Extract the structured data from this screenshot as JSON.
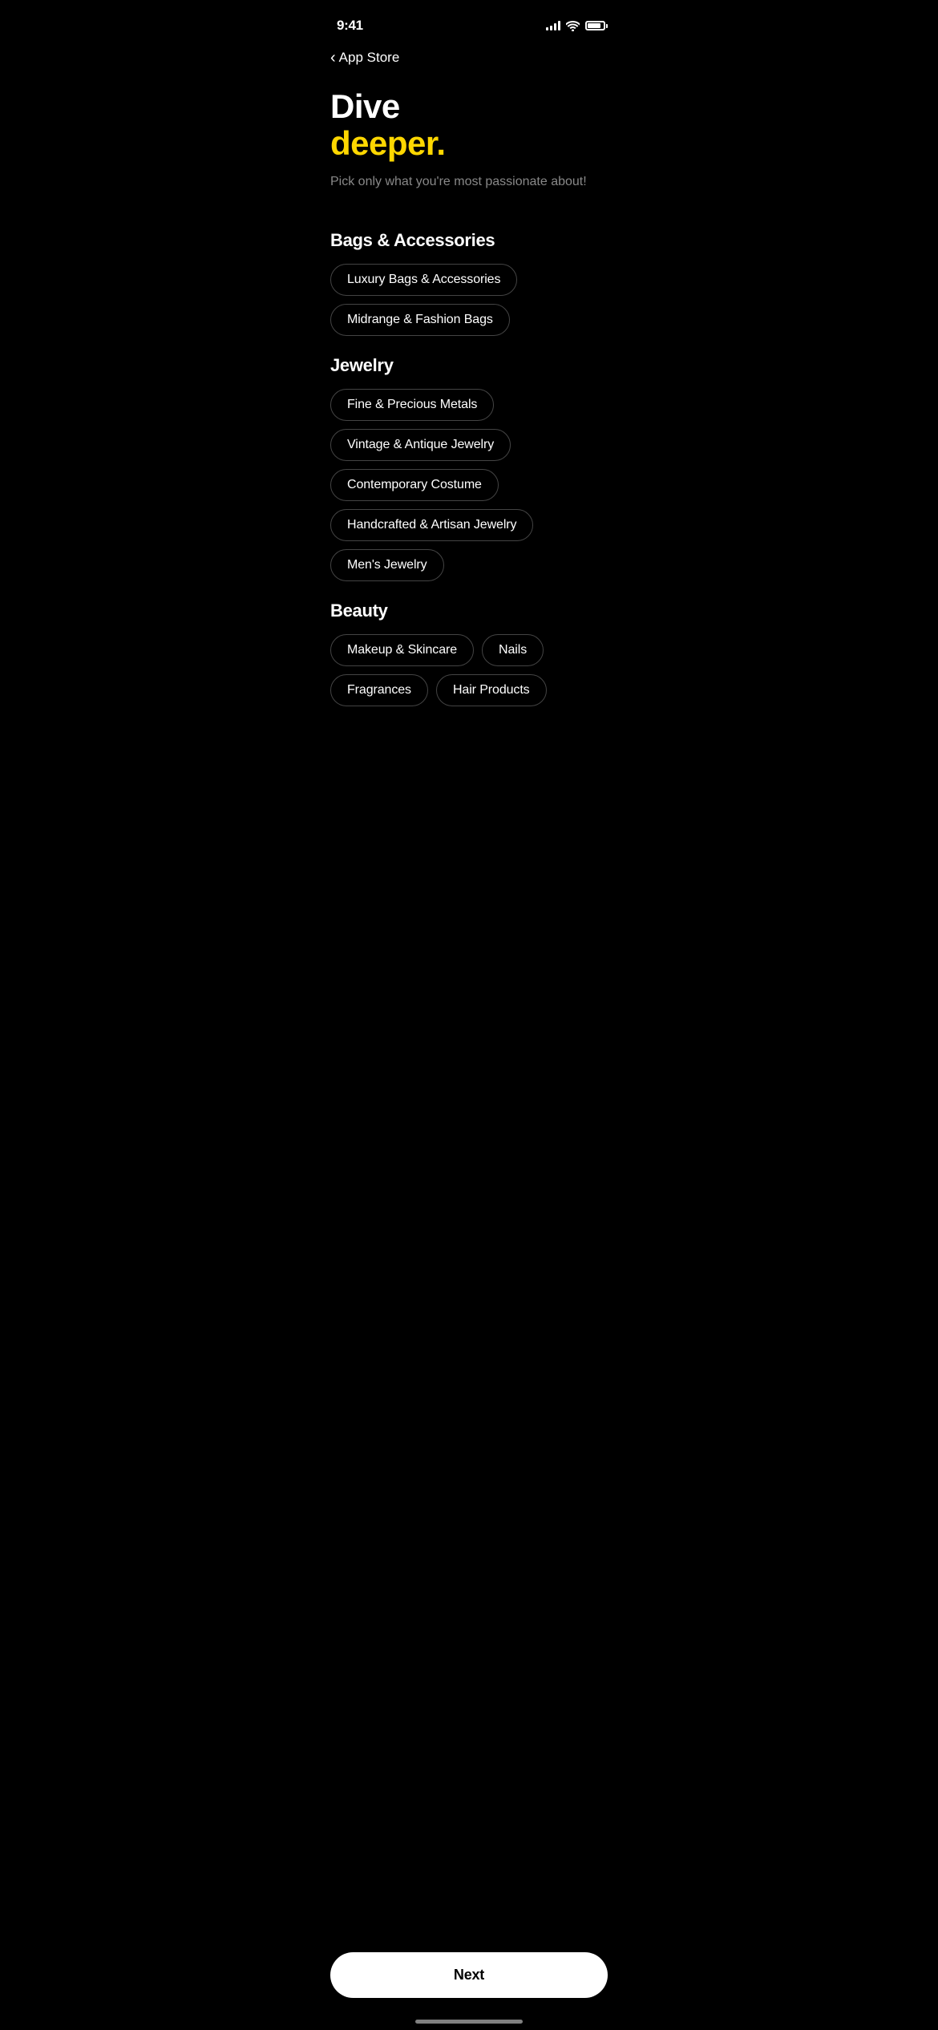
{
  "statusBar": {
    "time": "9:41",
    "appStore": "App Store"
  },
  "header": {
    "titleWhite": "Dive",
    "titleYellow": "deeper.",
    "subtitle": "Pick only what you're most passionate about!"
  },
  "sections": [
    {
      "id": "bags-accessories",
      "title": "Bags & Accessories",
      "tags": [
        {
          "id": "luxury-bags",
          "label": "Luxury Bags & Accessories"
        },
        {
          "id": "midrange-bags",
          "label": "Midrange & Fashion Bags"
        }
      ]
    },
    {
      "id": "jewelry",
      "title": "Jewelry",
      "tags": [
        {
          "id": "fine-metals",
          "label": "Fine & Precious Metals"
        },
        {
          "id": "vintage-jewelry",
          "label": "Vintage & Antique Jewelry"
        },
        {
          "id": "contemporary",
          "label": "Contemporary Costume"
        },
        {
          "id": "handcrafted",
          "label": "Handcrafted & Artisan Jewelry"
        },
        {
          "id": "mens-jewelry",
          "label": "Men's Jewelry"
        }
      ]
    },
    {
      "id": "beauty",
      "title": "Beauty",
      "tags": [
        {
          "id": "makeup-skincare",
          "label": "Makeup & Skincare"
        },
        {
          "id": "nails",
          "label": "Nails"
        },
        {
          "id": "fragrances",
          "label": "Fragrances"
        },
        {
          "id": "hair-products",
          "label": "Hair Products"
        }
      ]
    }
  ],
  "nextButton": {
    "label": "Next"
  },
  "back": {
    "chevron": "‹"
  }
}
